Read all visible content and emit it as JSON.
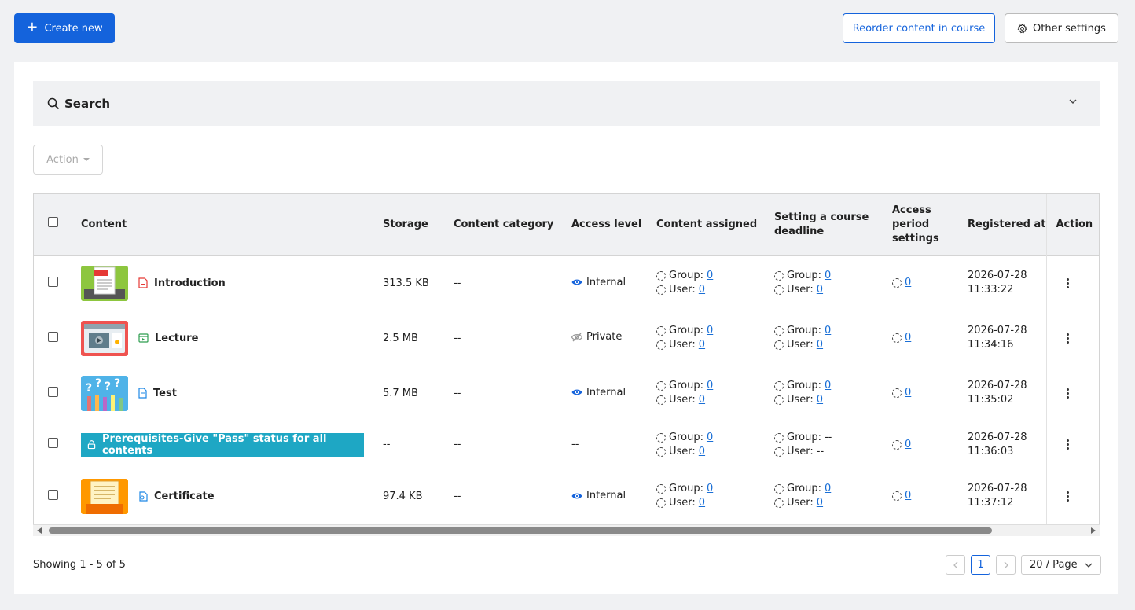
{
  "toolbar": {
    "create_label": "Create new",
    "reorder_label": "Reorder content in course",
    "settings_label": "Other settings"
  },
  "search": {
    "title": "Search"
  },
  "bulk": {
    "action_label": "Action"
  },
  "table": {
    "headers": {
      "content": "Content",
      "storage": "Storage",
      "category": "Content category",
      "access": "Access level",
      "assigned": "Content assigned",
      "deadline": "Setting a course deadline",
      "period": "Access period settings",
      "registered": "Registered at",
      "action": "Action"
    },
    "rows": [
      {
        "name": "Introduction",
        "type_icon": "pdf-icon",
        "thumb": "pdf-thumbnail",
        "storage": "313.5 KB",
        "category": "--",
        "access": "Internal",
        "access_icon": "eye-icon",
        "assigned_group": "0",
        "assigned_user": "0",
        "deadline_group": "0",
        "deadline_user": "0",
        "period": "0",
        "date": "2026-07-28",
        "time": "11:33:22"
      },
      {
        "name": "Lecture",
        "type_icon": "video-icon",
        "thumb": "video-thumbnail",
        "storage": "2.5 MB",
        "category": "--",
        "access": "Private",
        "access_icon": "eye-off-icon",
        "assigned_group": "0",
        "assigned_user": "0",
        "deadline_group": "0",
        "deadline_user": "0",
        "period": "0",
        "date": "2026-07-28",
        "time": "11:34:16"
      },
      {
        "name": "Test",
        "type_icon": "document-icon",
        "thumb": "quiz-thumbnail",
        "storage": "5.7 MB",
        "category": "--",
        "access": "Internal",
        "access_icon": "eye-icon",
        "assigned_group": "0",
        "assigned_user": "0",
        "deadline_group": "0",
        "deadline_user": "0",
        "period": "0",
        "date": "2026-07-28",
        "time": "11:35:02"
      },
      {
        "name": "Prerequisites-Give \"Pass\" status for all contents",
        "type_icon": "unlock-icon",
        "storage": "--",
        "category": "--",
        "access": "--",
        "assigned_group": "0",
        "assigned_user": "0",
        "deadline_group": "--",
        "deadline_user": "--",
        "period": "0",
        "date": "2026-07-28",
        "time": "11:36:03"
      },
      {
        "name": "Certificate",
        "type_icon": "certificate-icon",
        "thumb": "certificate-thumbnail",
        "storage": "97.4 KB",
        "category": "--",
        "access": "Internal",
        "access_icon": "eye-icon",
        "assigned_group": "0",
        "assigned_user": "0",
        "deadline_group": "0",
        "deadline_user": "0",
        "period": "0",
        "date": "2026-07-28",
        "time": "11:37:12"
      }
    ],
    "labels": {
      "group": "Group:",
      "user": "User:"
    }
  },
  "footer": {
    "showing": "Showing 1 - 5 of 5",
    "current_page": "1",
    "page_size": "20 / Page"
  },
  "colors": {
    "primary": "#1463dc",
    "prereq_bg": "#1ea7c4"
  }
}
